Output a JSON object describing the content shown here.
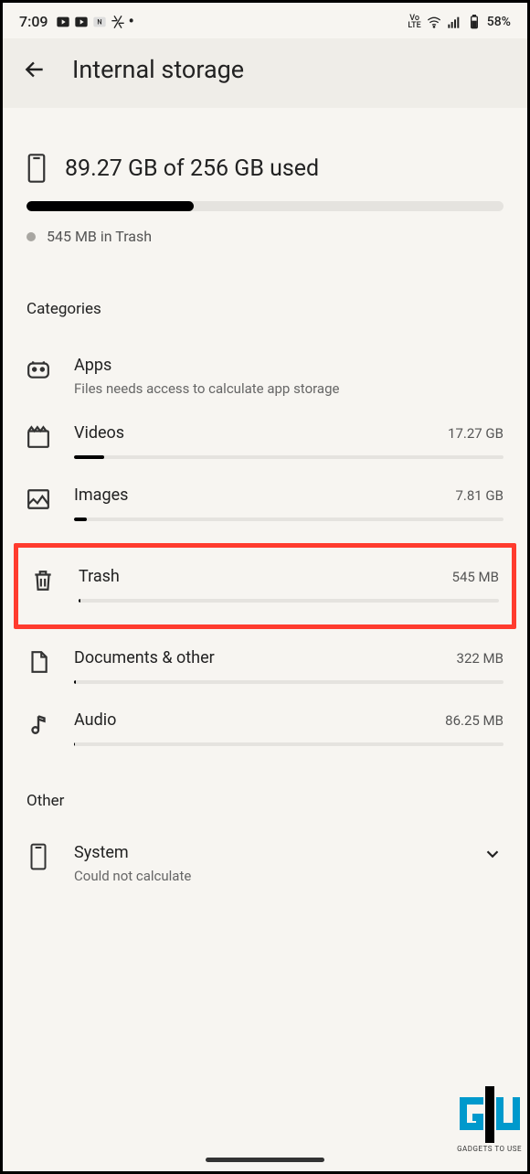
{
  "status": {
    "time": "7:09",
    "battery": "58%"
  },
  "header": {
    "title": "Internal storage"
  },
  "summary": {
    "text": "89.27 GB of 256 GB used",
    "progress_pct": 35,
    "trash_note": "545 MB in Trash"
  },
  "sections": {
    "categories_label": "Categories",
    "other_label": "Other"
  },
  "categories": [
    {
      "icon": "apps",
      "label": "Apps",
      "sub": "Files needs access to calculate app storage",
      "size": "",
      "bar_pct": null
    },
    {
      "icon": "videos",
      "label": "Videos",
      "sub": "",
      "size": "17.27 GB",
      "bar_pct": 7
    },
    {
      "icon": "images",
      "label": "Images",
      "sub": "",
      "size": "7.81 GB",
      "bar_pct": 3
    },
    {
      "icon": "trash",
      "label": "Trash",
      "sub": "",
      "size": "545 MB",
      "bar_pct": 0.5,
      "highlight": true
    },
    {
      "icon": "documents",
      "label": "Documents & other",
      "sub": "",
      "size": "322 MB",
      "bar_pct": 0.4
    },
    {
      "icon": "audio",
      "label": "Audio",
      "sub": "",
      "size": "86.25 MB",
      "bar_pct": 0.2
    }
  ],
  "system": {
    "label": "System",
    "sub": "Could not calculate"
  },
  "watermark": "GADGETS TO USE"
}
